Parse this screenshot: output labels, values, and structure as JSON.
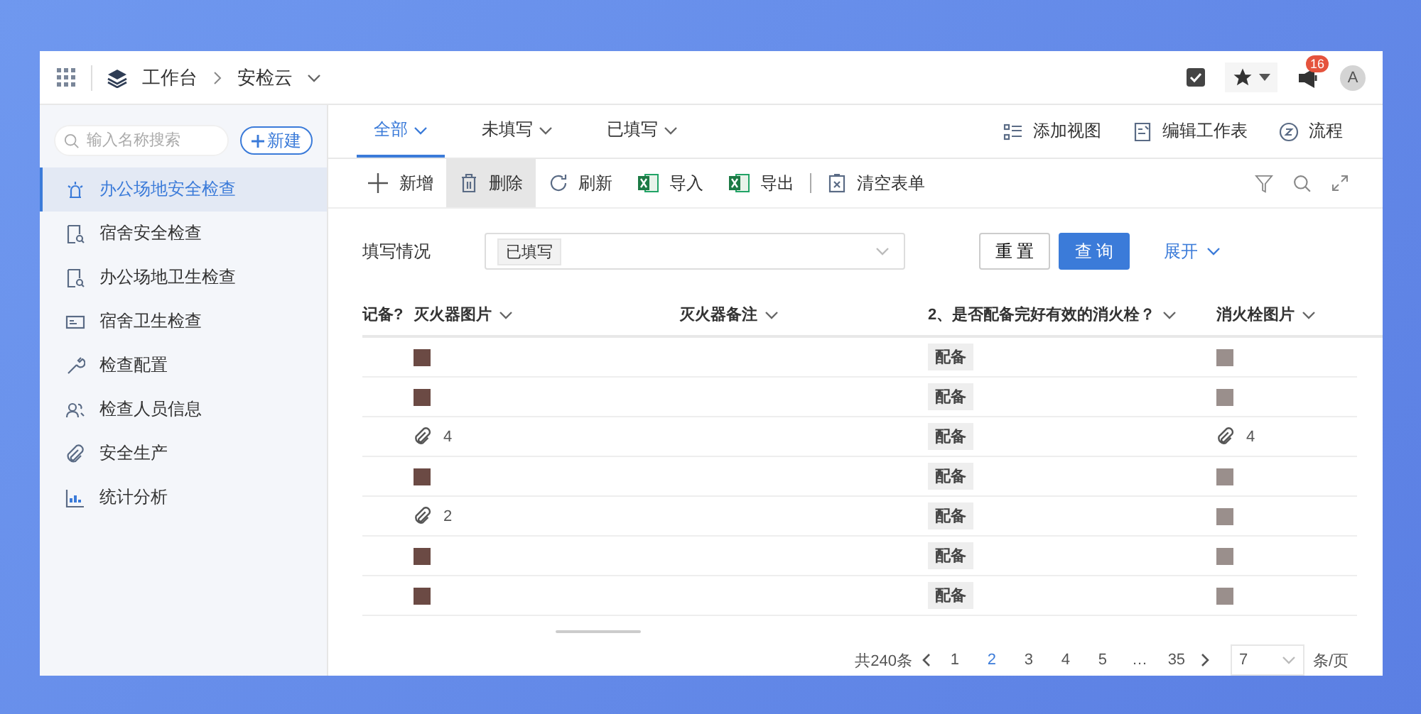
{
  "header": {
    "breadcrumb": [
      "工作台",
      "安检云"
    ],
    "notification_badge": "16",
    "avatar_letter": "A"
  },
  "sidebar": {
    "search": {
      "placeholder": "输入名称搜索"
    },
    "new_button": "新建",
    "items": [
      {
        "label": "办公场地安全检查",
        "kind": "alarm",
        "selected": true
      },
      {
        "label": "宿舍安全检查",
        "kind": "docsearch",
        "selected": false
      },
      {
        "label": "办公场地卫生检查",
        "kind": "docsearch",
        "selected": false
      },
      {
        "label": "宿舍卫生检查",
        "kind": "card",
        "selected": false
      },
      {
        "label": "检查配置",
        "kind": "wrench",
        "selected": false
      },
      {
        "label": "检查人员信息",
        "kind": "people",
        "selected": false
      },
      {
        "label": "安全生产",
        "kind": "clip",
        "selected": false
      },
      {
        "label": "统计分析",
        "kind": "chart",
        "selected": false
      }
    ]
  },
  "view_tabs": [
    {
      "label": "全部",
      "selected": true
    },
    {
      "label": "未填写",
      "selected": false
    },
    {
      "label": "已填写",
      "selected": false
    }
  ],
  "view_actions": [
    {
      "label": "添加视图",
      "kind": "list"
    },
    {
      "label": "编辑工作表",
      "kind": "edit"
    },
    {
      "label": "流程",
      "kind": "flow"
    }
  ],
  "toolbar": [
    {
      "label": "新增",
      "kind": "plus",
      "hovered": false
    },
    {
      "label": "删除",
      "kind": "trash",
      "hovered": true
    },
    {
      "label": "刷新",
      "kind": "refresh",
      "hovered": false
    },
    {
      "label": "导入",
      "kind": "excel",
      "hovered": false
    },
    {
      "label": "导出",
      "kind": "excel",
      "hovered": false
    },
    {
      "label": "清空表单",
      "kind": "clear",
      "hovered": false
    }
  ],
  "filter": {
    "label": "填写情况",
    "value": "已填写",
    "reset": "重 置",
    "query": "查 询",
    "expand": "展开"
  },
  "table": {
    "columns": [
      "记备?",
      "灭火器图片",
      "灭火器备注",
      "2、是否配备完好有效的消火栓？",
      "消火栓图片"
    ],
    "rows": [
      {
        "extinguisher": {
          "kind": "photo"
        },
        "hydrant": "配备",
        "hydrant_photo": {
          "kind": "photo"
        }
      },
      {
        "extinguisher": {
          "kind": "photo"
        },
        "hydrant": "配备",
        "hydrant_photo": {
          "kind": "photo"
        }
      },
      {
        "extinguisher": {
          "kind": "attachment",
          "count": "4"
        },
        "hydrant": "配备",
        "hydrant_photo": {
          "kind": "attachment",
          "count": "4"
        }
      },
      {
        "extinguisher": {
          "kind": "photo"
        },
        "hydrant": "配备",
        "hydrant_photo": {
          "kind": "photo"
        }
      },
      {
        "extinguisher": {
          "kind": "attachment",
          "count": "2"
        },
        "hydrant": "配备",
        "hydrant_photo": {
          "kind": "photo"
        }
      },
      {
        "extinguisher": {
          "kind": "photo"
        },
        "hydrant": "配备",
        "hydrant_photo": {
          "kind": "photo"
        }
      },
      {
        "extinguisher": {
          "kind": "photo"
        },
        "hydrant": "配备",
        "hydrant_photo": {
          "kind": "photo"
        }
      }
    ]
  },
  "pagination": {
    "total": "共240条",
    "pages": [
      {
        "label": "1",
        "selected": false
      },
      {
        "label": "2",
        "selected": true
      },
      {
        "label": "3",
        "selected": false
      },
      {
        "label": "4",
        "selected": false
      },
      {
        "label": "5",
        "selected": false
      },
      {
        "label": "…",
        "selected": false
      },
      {
        "label": "35",
        "selected": false
      }
    ],
    "page_size": "7",
    "per_page": "条/页"
  }
}
